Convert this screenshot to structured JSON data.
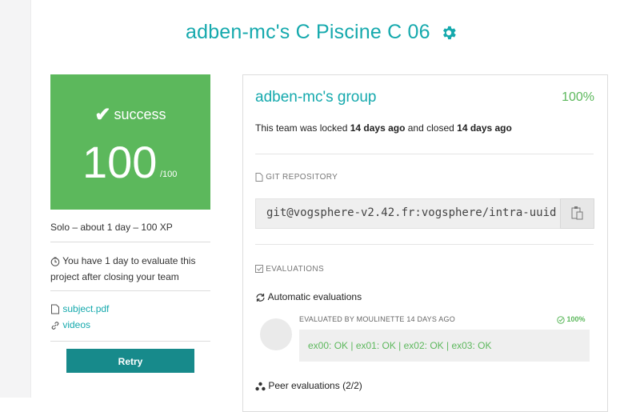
{
  "header": {
    "project_title": "adben-mc's C Piscine C 06"
  },
  "score_card": {
    "status": "success",
    "value": "100",
    "max": "/100",
    "color": "#5cb85c"
  },
  "sidebar": {
    "meta": "Solo – about 1 day – 100 XP",
    "evaluate_notice": "You have 1 day to evaluate this project after closing your team",
    "attachments": [
      {
        "label": "subject.pdf",
        "icon": "document-icon"
      },
      {
        "label": "videos",
        "icon": "link-icon"
      }
    ],
    "retry_label": "Retry"
  },
  "group": {
    "title": "adben-mc's group",
    "percent": "100%",
    "locked_prefix": "This team was locked ",
    "locked_time": "14 days ago",
    "closed_prefix": " and closed ",
    "closed_time": "14 days ago"
  },
  "git": {
    "header": "GIT REPOSITORY",
    "url": "git@vogsphere-v2.42.fr:vogsphere/intra-uuid"
  },
  "evaluations": {
    "header": "EVALUATIONS",
    "automatic_label": "Automatic evaluations",
    "evaluated_by": "EVALUATED BY MOULINETTE 14 DAYS AGO",
    "auto_percent": "100%",
    "result": "ex00: OK | ex01: OK | ex02: OK | ex03: OK",
    "peer_label": "Peer evaluations (2/2)"
  },
  "colors": {
    "accent": "#15a9ad",
    "success": "#5cb85c",
    "retry": "#178a8b"
  }
}
